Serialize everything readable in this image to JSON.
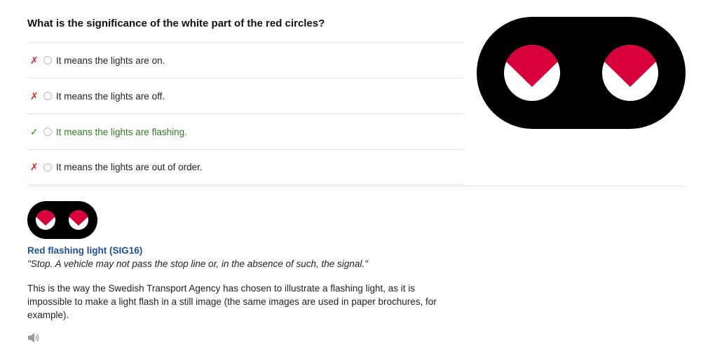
{
  "question": "What is the significance of the white part of the red circles?",
  "answers": [
    {
      "mark": "✗",
      "text": "It means the lights are on.",
      "correct": false
    },
    {
      "mark": "✗",
      "text": "It means the lights are off.",
      "correct": false
    },
    {
      "mark": "✓",
      "text": "It means the lights are flashing.",
      "correct": true
    },
    {
      "mark": "✗",
      "text": "It means the lights are out of order.",
      "correct": false
    }
  ],
  "sign": {
    "title": "Red flashing light (SIG16)",
    "quote": "\"Stop. A vehicle may not pass the stop line or, in the absence of such, the signal.\""
  },
  "explanation": "This is the way the Swedish Transport Agency has chosen to illustrate a flashing light, as it is impossible to make a light flash in a still image (the same images are used in paper brochures, for example).",
  "icons": {
    "sign_image": "red-flashing-light-sign-icon",
    "audio": "speaker-icon"
  },
  "colors": {
    "signal_red": "#d8003a",
    "correct_green": "#2e7d1f",
    "wrong_red": "#d9262e",
    "title_blue": "#1d4f9a"
  }
}
